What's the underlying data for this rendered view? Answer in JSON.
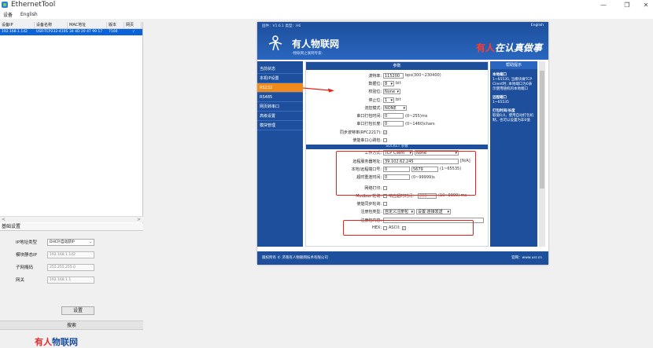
{
  "window": {
    "title": "EthernetTool",
    "controls": {
      "minimize": "—",
      "maximize": "❐",
      "close": "✕"
    }
  },
  "menu": [
    "设备",
    "English"
  ],
  "device_list": {
    "columns": [
      "设备IP",
      "设备名称",
      "MAC地址",
      "版本",
      "网页"
    ],
    "rows": [
      {
        "ip": "192.168.1.142",
        "name": "USR-TCP232-410S",
        "mac": "34 4D 20 47 99 17",
        "version": "7100",
        "web": "✓"
      }
    ]
  },
  "scroll_arrows": {
    "left": "<",
    "right": ">"
  },
  "basic_settings": {
    "header": "基础设置",
    "fields": [
      {
        "label": "IP地址类型",
        "value": "DHCP/自动获IP"
      },
      {
        "label": "模块静态IP",
        "value": "192.168.1.142"
      },
      {
        "label": "子网掩码",
        "value": "255.255.255.0"
      },
      {
        "label": "网关",
        "value": "192.168.1.1"
      }
    ],
    "set_button": "设置",
    "search_button": "搜索",
    "logo_red": "有人",
    "logo_blue": "物联网"
  },
  "device_page": {
    "version": "固件：V1.6.1 类型：H6",
    "switch_lang": "English",
    "brand": "有人物联网",
    "brand_sub": "-物联网之联网专家-",
    "slogan_red": "有人",
    "slogan_white": "在认真做事",
    "nav": [
      "当前状态",
      "本机IP设置",
      "RS232",
      "RS485",
      "网页转串口",
      "高级设置",
      "模块管理"
    ],
    "nav_active_index": 2,
    "params_header": "参数",
    "params": [
      {
        "label": "波特率:",
        "value": "115200",
        "suffix": "bps(300~230400)",
        "kind": "input",
        "width": 26
      },
      {
        "label": "数据位:",
        "value": "8",
        "suffix": "bit",
        "kind": "select",
        "width": 14
      },
      {
        "label": "校验位:",
        "value": "None",
        "suffix": "",
        "kind": "select",
        "width": 22
      },
      {
        "label": "停止位:",
        "value": "1",
        "suffix": "bit",
        "kind": "select",
        "width": 14
      },
      {
        "label": "流控模式:",
        "value": "NONE",
        "suffix": "",
        "kind": "select",
        "width": 30
      },
      {
        "label": "串口打包时间:",
        "value": "0",
        "suffix": "(0~255)ms",
        "kind": "input",
        "width": 26
      },
      {
        "label": "串口打包长度:",
        "value": "0",
        "suffix": "(0~1460)chars",
        "kind": "input",
        "width": 26
      },
      {
        "label": "同步波特率(RFC2217):",
        "value": "✓",
        "suffix": "",
        "kind": "check",
        "width": 0
      },
      {
        "label": "使能串口心跳包:",
        "value": "",
        "suffix": "",
        "kind": "check",
        "width": 0
      }
    ],
    "socket_header": "SOCKET 参数",
    "socket": [
      {
        "label": "工作方式:",
        "value": "TCP Client",
        "value2": "None",
        "suffix": ""
      },
      {
        "label": "远程服务器地址:",
        "value": "39.102.62.245",
        "suffix": "[N/A]"
      },
      {
        "label": "本地/远程端口号:",
        "value": "0",
        "value2": "5679",
        "suffix": "(1~65535)"
      },
      {
        "label": "超时重连时间:",
        "value": "0",
        "suffix": "(0~99999)s"
      }
    ],
    "misc": [
      {
        "label": "网络打印:",
        "value": "",
        "extra": ""
      },
      {
        "label": "Modbus 轮询:",
        "value": "",
        "extra": "响应超时时间：",
        "extra_value": "200",
        "suffix": "(10~9999) ms"
      },
      {
        "label": "使能同步轮询:",
        "value": "",
        "extra": ""
      }
    ],
    "register": {
      "label": "注册包类型:",
      "value": "自定义注册包",
      "value2": "设置:连接发送"
    },
    "register_content": {
      "label": "注册包内容:",
      "value": ""
    },
    "hex": {
      "label": "HEX:",
      "ascii": "ASCII:",
      "ascii_check": "✓"
    },
    "help_header": "帮助提示",
    "help": [
      {
        "title": "本地端口",
        "text": "1~65535, 当模块做TCP Client时, 本地端口为0表示使用随机的本地端口"
      },
      {
        "title": "远程端口",
        "text": "1~65535"
      },
      {
        "title": "打包时间/长度",
        "text": "取值0,0，使用自动打包机制，也可以设置为非0值"
      }
    ],
    "footer_left": "版权所有 © 济南有人物联网技术有限公司",
    "footer_right": "官网：www.usr.cn"
  },
  "colors": {
    "accent": "#1d4f9c",
    "highlight": "#e8221b",
    "active": "#f08a1a"
  }
}
